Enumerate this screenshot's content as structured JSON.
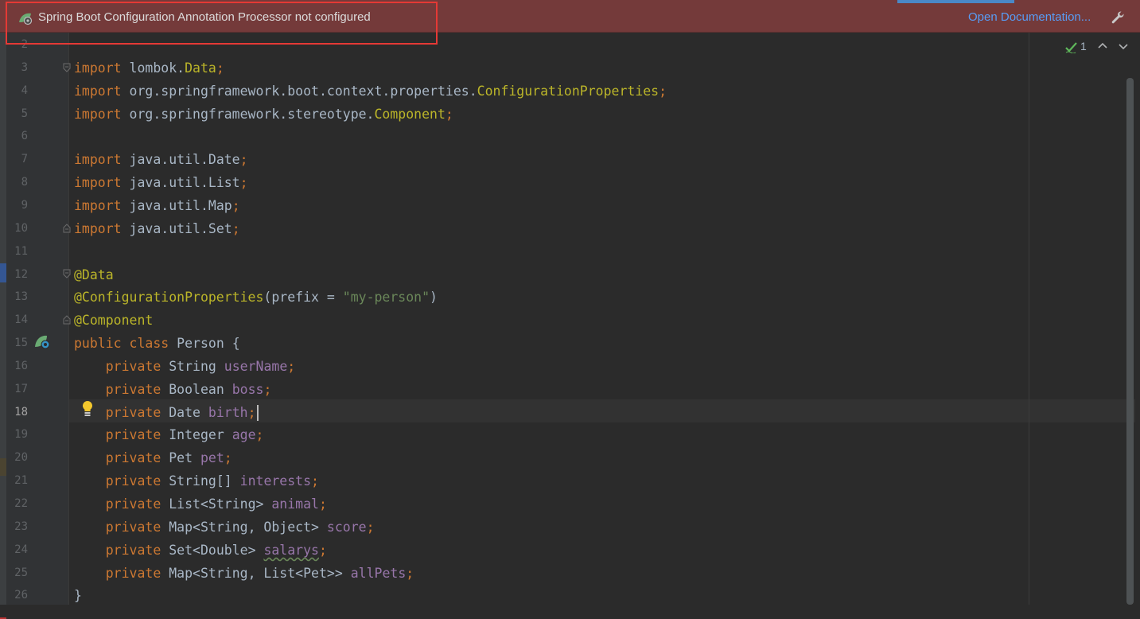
{
  "banner": {
    "message": "Spring Boot Configuration Annotation Processor not configured",
    "link": "Open Documentation...",
    "icon": "spring-boot-icon",
    "action_icon": "wrench-icon"
  },
  "inspections": {
    "count": "1",
    "icon": "check-icon"
  },
  "editor": {
    "current_line": "18",
    "lines": [
      {
        "no": "2",
        "segments": []
      },
      {
        "no": "3",
        "segments": [
          {
            "t": "import",
            "c": "kw"
          },
          {
            "t": " lombok."
          },
          {
            "t": "Data",
            "c": "ann"
          },
          {
            "t": ";",
            "c": "kw"
          }
        ]
      },
      {
        "no": "4",
        "segments": [
          {
            "t": "import",
            "c": "kw"
          },
          {
            "t": " org.springframework.boot.context.properties."
          },
          {
            "t": "ConfigurationProperties",
            "c": "ann"
          },
          {
            "t": ";",
            "c": "kw"
          }
        ]
      },
      {
        "no": "5",
        "segments": [
          {
            "t": "import",
            "c": "kw"
          },
          {
            "t": " org.springframework.stereotype."
          },
          {
            "t": "Component",
            "c": "ann"
          },
          {
            "t": ";",
            "c": "kw"
          }
        ]
      },
      {
        "no": "6",
        "segments": []
      },
      {
        "no": "7",
        "segments": [
          {
            "t": "import",
            "c": "kw"
          },
          {
            "t": " java.util.Date"
          },
          {
            "t": ";",
            "c": "kw"
          }
        ]
      },
      {
        "no": "8",
        "segments": [
          {
            "t": "import",
            "c": "kw"
          },
          {
            "t": " java.util.List"
          },
          {
            "t": ";",
            "c": "kw"
          }
        ]
      },
      {
        "no": "9",
        "segments": [
          {
            "t": "import",
            "c": "kw"
          },
          {
            "t": " java.util.Map"
          },
          {
            "t": ";",
            "c": "kw"
          }
        ]
      },
      {
        "no": "10",
        "segments": [
          {
            "t": "import",
            "c": "kw"
          },
          {
            "t": " java.util.Set"
          },
          {
            "t": ";",
            "c": "kw"
          }
        ]
      },
      {
        "no": "11",
        "segments": []
      },
      {
        "no": "12",
        "segments": [
          {
            "t": "@Data",
            "c": "ann"
          }
        ]
      },
      {
        "no": "13",
        "segments": [
          {
            "t": "@ConfigurationProperties",
            "c": "ann"
          },
          {
            "t": "(prefix = "
          },
          {
            "t": "\"my-person\"",
            "c": "str"
          },
          {
            "t": ")"
          }
        ]
      },
      {
        "no": "14",
        "segments": [
          {
            "t": "@Component",
            "c": "ann"
          }
        ]
      },
      {
        "no": "15",
        "segments": [
          {
            "t": "public class",
            "c": "kw"
          },
          {
            "t": " Person {"
          }
        ]
      },
      {
        "no": "16",
        "segments": [
          {
            "t": "    "
          },
          {
            "t": "private",
            "c": "kw"
          },
          {
            "t": " String "
          },
          {
            "t": "userName",
            "c": "fld"
          },
          {
            "t": ";",
            "c": "kw"
          }
        ]
      },
      {
        "no": "17",
        "segments": [
          {
            "t": "    "
          },
          {
            "t": "private",
            "c": "kw"
          },
          {
            "t": " Boolean "
          },
          {
            "t": "boss",
            "c": "fld"
          },
          {
            "t": ";",
            "c": "kw"
          }
        ]
      },
      {
        "no": "18",
        "segments": [
          {
            "t": "    "
          },
          {
            "t": "private",
            "c": "kw"
          },
          {
            "t": " Date "
          },
          {
            "t": "birth",
            "c": "fld"
          },
          {
            "t": ";",
            "c": "kw"
          }
        ],
        "caret": true
      },
      {
        "no": "19",
        "segments": [
          {
            "t": "    "
          },
          {
            "t": "private",
            "c": "kw"
          },
          {
            "t": " Integer "
          },
          {
            "t": "age",
            "c": "fld"
          },
          {
            "t": ";",
            "c": "kw"
          }
        ]
      },
      {
        "no": "20",
        "segments": [
          {
            "t": "    "
          },
          {
            "t": "private",
            "c": "kw"
          },
          {
            "t": " Pet "
          },
          {
            "t": "pet",
            "c": "fld"
          },
          {
            "t": ";",
            "c": "kw"
          }
        ]
      },
      {
        "no": "21",
        "segments": [
          {
            "t": "    "
          },
          {
            "t": "private",
            "c": "kw"
          },
          {
            "t": " String[] "
          },
          {
            "t": "interests",
            "c": "fld"
          },
          {
            "t": ";",
            "c": "kw"
          }
        ]
      },
      {
        "no": "22",
        "segments": [
          {
            "t": "    "
          },
          {
            "t": "private",
            "c": "kw"
          },
          {
            "t": " List<String> "
          },
          {
            "t": "animal",
            "c": "fld"
          },
          {
            "t": ";",
            "c": "kw"
          }
        ]
      },
      {
        "no": "23",
        "segments": [
          {
            "t": "    "
          },
          {
            "t": "private",
            "c": "kw"
          },
          {
            "t": " Map<String, Object> "
          },
          {
            "t": "score",
            "c": "fld"
          },
          {
            "t": ";",
            "c": "kw"
          }
        ]
      },
      {
        "no": "24",
        "segments": [
          {
            "t": "    "
          },
          {
            "t": "private",
            "c": "kw"
          },
          {
            "t": " Set<Double> "
          },
          {
            "t": "salarys",
            "c": "fld typo"
          },
          {
            "t": ";",
            "c": "kw"
          }
        ]
      },
      {
        "no": "25",
        "segments": [
          {
            "t": "    "
          },
          {
            "t": "private",
            "c": "kw"
          },
          {
            "t": " Map<String, List<Pet>> "
          },
          {
            "t": "allPets",
            "c": "fld"
          },
          {
            "t": ";",
            "c": "kw"
          }
        ]
      },
      {
        "no": "26",
        "segments": [
          {
            "t": "}"
          }
        ]
      }
    ]
  },
  "colors": {
    "keyword": "#cc7832",
    "annotation": "#bbb529",
    "string": "#6a8759",
    "field": "#9876aa",
    "banner_bg": "#743a3a",
    "link": "#589df6",
    "highlight_box": "#e53935"
  }
}
